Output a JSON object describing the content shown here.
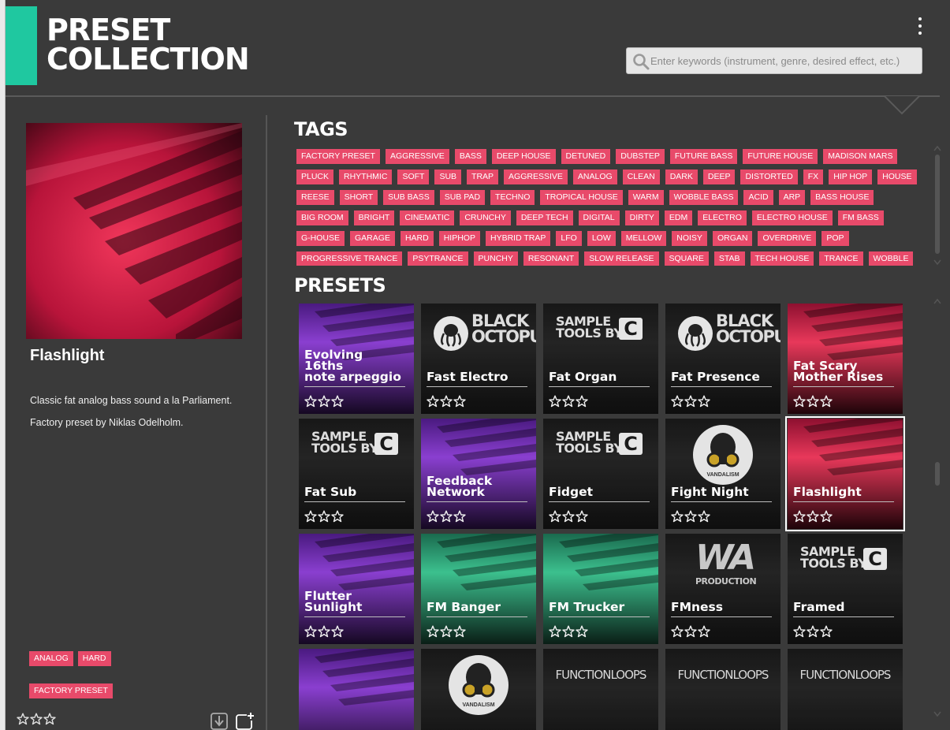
{
  "header": {
    "title_line1": "PRESET",
    "title_line2": "COLLECTION",
    "search_placeholder": "Enter keywords (instrument, genre, desired effect, etc.)"
  },
  "colors": {
    "accent": "#1fc8a0",
    "tag": "#e84a6a",
    "background": "#3a3a3a"
  },
  "selected_preset": {
    "name": "Flashlight",
    "description_line1": "Classic fat analog bass sound a la Parliament.",
    "description_line2": "Factory preset by Niklas Odelholm.",
    "tags_row1": [
      "ANALOG",
      "HARD"
    ],
    "tags_row2": [
      "FACTORY PRESET"
    ],
    "rating": 0
  },
  "tags_section": {
    "title": "TAGS",
    "tags": [
      "FACTORY PRESET",
      "AGGRESSIVE",
      "BASS",
      "DEEP HOUSE",
      "DETUNED",
      "DUBSTEP",
      "FUTURE BASS",
      "FUTURE HOUSE",
      "MADISON MARS",
      "PLUCK",
      "RHYTHMIC",
      "SOFT",
      "SUB",
      "TRAP",
      "AGGRESSIVE",
      "ANALOG",
      "CLEAN",
      "DARK",
      "DEEP",
      "DISTORTED",
      "FX",
      "HIP HOP",
      "HOUSE",
      "REESE",
      "SHORT",
      "SUB BASS",
      "SUB PAD",
      "TECHNO",
      "TROPICAL HOUSE",
      "WARM",
      "WOBBLE BASS",
      "ACID",
      "ARP",
      "BASS HOUSE",
      "BIG ROOM",
      "BRIGHT",
      "CINEMATIC",
      "CRUNCHY",
      "DEEP TECH",
      "DIGITAL",
      "DIRTY",
      "EDM",
      "ELECTRO",
      "ELECTRO HOUSE",
      "FM BASS",
      "G-HOUSE",
      "GARAGE",
      "HARD",
      "HIPHOP",
      "HYBRID TRAP",
      "LFO",
      "LOW",
      "MELLOW",
      "NOISY",
      "ORGAN",
      "OVERDRIVE",
      "POP",
      "PROGRESSIVE TRANCE",
      "PSYTRANCE",
      "PUNCHY",
      "RESONANT",
      "SLOW RELEASE",
      "SQUARE",
      "STAB",
      "TECH HOUSE",
      "TRANCE",
      "WOBBLE"
    ]
  },
  "presets_section": {
    "title": "PRESETS",
    "items": [
      {
        "name_line1": "Evolving 16ths",
        "name_line2": "note arpeggio",
        "art": "purple",
        "logo": "",
        "rating": 0
      },
      {
        "name_line1": "Fast Electro",
        "name_line2": "",
        "art": "dark",
        "logo": "black-octopus",
        "logo_text1": "BLACK",
        "logo_text2": "OCTOPUS",
        "rating": 0
      },
      {
        "name_line1": "Fat Organ",
        "name_line2": "",
        "art": "dark",
        "logo": "sample-tools",
        "logo_text1": "SAMPLE",
        "logo_text2": "TOOLS BY",
        "logo_text3": "C",
        "rating": 0
      },
      {
        "name_line1": "Fat Presence",
        "name_line2": "",
        "art": "dark",
        "logo": "black-octopus",
        "logo_text1": "BLACK",
        "logo_text2": "OCTOPUS",
        "rating": 0
      },
      {
        "name_line1": "Fat Scary",
        "name_line2": "Mother Rises",
        "art": "red",
        "logo": "",
        "rating": 0
      },
      {
        "name_line1": "Fat Sub",
        "name_line2": "",
        "art": "dark",
        "logo": "sample-tools",
        "logo_text1": "SAMPLE",
        "logo_text2": "TOOLS BY",
        "logo_text3": "C",
        "rating": 0
      },
      {
        "name_line1": "Feedback",
        "name_line2": "Network",
        "art": "purple",
        "logo": "",
        "rating": 0
      },
      {
        "name_line1": "Fidget",
        "name_line2": "",
        "art": "dark",
        "logo": "sample-tools",
        "logo_text1": "SAMPLE",
        "logo_text2": "TOOLS BY",
        "logo_text3": "C",
        "rating": 0
      },
      {
        "name_line1": "Fight Night",
        "name_line2": "",
        "art": "dark",
        "logo": "vandalism",
        "logo_text1": "VANDALISM",
        "rating": 0
      },
      {
        "name_line1": "Flashlight",
        "name_line2": "",
        "art": "red",
        "logo": "",
        "rating": 0,
        "selected": true
      },
      {
        "name_line1": "Flutter Sunlight",
        "name_line2": "",
        "art": "purple",
        "logo": "",
        "rating": 0
      },
      {
        "name_line1": "FM Banger",
        "name_line2": "",
        "art": "green",
        "logo": "",
        "rating": 0
      },
      {
        "name_line1": "FM Trucker",
        "name_line2": "",
        "art": "green",
        "logo": "",
        "rating": 0
      },
      {
        "name_line1": "FMness",
        "name_line2": "",
        "art": "dark",
        "logo": "wa-production",
        "logo_text1": "WA",
        "logo_text2": "PRODUCTION",
        "rating": 0
      },
      {
        "name_line1": "Framed",
        "name_line2": "",
        "art": "dark",
        "logo": "sample-tools",
        "logo_text1": "SAMPLE",
        "logo_text2": "TOOLS BY",
        "logo_text3": "C",
        "rating": 0
      },
      {
        "name_line1": "",
        "name_line2": "",
        "art": "purple",
        "logo": "",
        "rating": 0
      },
      {
        "name_line1": "",
        "name_line2": "",
        "art": "dark",
        "logo": "vandalism",
        "logo_text1": "VANDALISM",
        "rating": 0
      },
      {
        "name_line1": "",
        "name_line2": "",
        "art": "dark",
        "logo": "function-loops",
        "logo_text1": "FUNCTIONLOOPS",
        "rating": 0
      },
      {
        "name_line1": "",
        "name_line2": "",
        "art": "dark",
        "logo": "function-loops",
        "logo_text1": "FUNCTIONLOOPS",
        "rating": 0
      },
      {
        "name_line1": "",
        "name_line2": "",
        "art": "dark",
        "logo": "function-loops",
        "logo_text1": "FUNCTIONLOOPS",
        "rating": 0
      }
    ]
  },
  "icons": {
    "menu": "vertical-dots-icon",
    "search": "search-icon",
    "download": "download-icon",
    "add": "add-to-list-icon",
    "star": "star-outline-icon"
  }
}
